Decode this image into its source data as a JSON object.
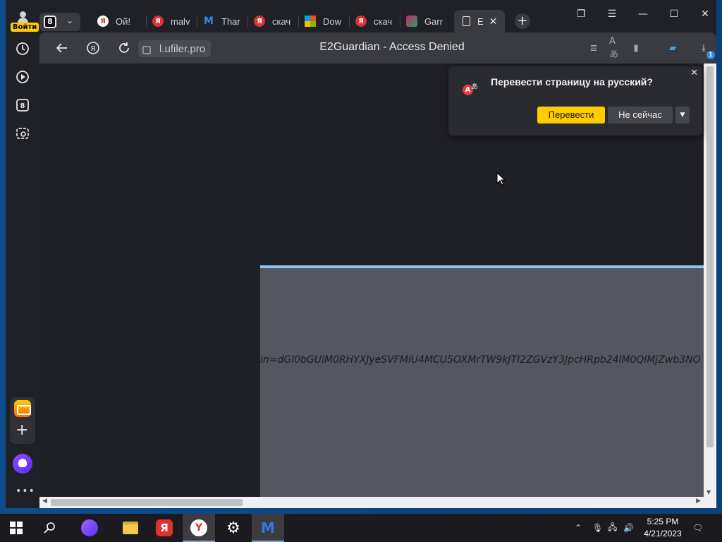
{
  "sidebar": {
    "login_label": "Войти",
    "tabs_count": "8"
  },
  "tabs": [
    {
      "label": "Ой!",
      "icon": "yandex-icon",
      "color": "#ffffff",
      "fg": "#e03030"
    },
    {
      "label": "malv",
      "icon": "yandex-icon",
      "color": "#e03030",
      "fg": "#ffffff"
    },
    {
      "label": "Thar",
      "icon": "malwarebytes-icon",
      "color": "#1f6ed4",
      "fg": "#ffffff"
    },
    {
      "label": "скач",
      "icon": "yandex-icon",
      "color": "#e03030",
      "fg": "#ffffff"
    },
    {
      "label": "Dow",
      "icon": "microsoft-icon",
      "color": "#ffffff",
      "fg": "#ffffff"
    },
    {
      "label": "скач",
      "icon": "yandex-icon",
      "color": "#e03030",
      "fg": "#ffffff"
    },
    {
      "label": "Garr",
      "icon": "game-icon",
      "color": "#d3206f",
      "fg": "#ffffff"
    },
    {
      "label": "E",
      "icon": "page-icon",
      "color": "#3a3b40",
      "fg": "#ffffff"
    }
  ],
  "toolbar": {
    "url": "l.ufiler.pro",
    "page_title": "E2Guardian - Access Denied",
    "download_count": "1"
  },
  "translate_popup": {
    "question": "Перевести страницу на русский?",
    "translate_label": "Перевести",
    "not_now_label": "Не сейчас"
  },
  "content": {
    "blocked_url_text": "in=dGl0bGUlM0RHYXJyeSVFMiU4MCU5OXMrTW9kJTI2ZGVzY3JpcHRpb24lM0QlMjZwb3NO"
  },
  "taskbar": {
    "time": "5:25 PM",
    "date": "4/21/2023"
  },
  "colors": {
    "accent_yellow": "#ffcc00",
    "panel_border": "#8ec3f0",
    "panel_bg": "#545660"
  }
}
